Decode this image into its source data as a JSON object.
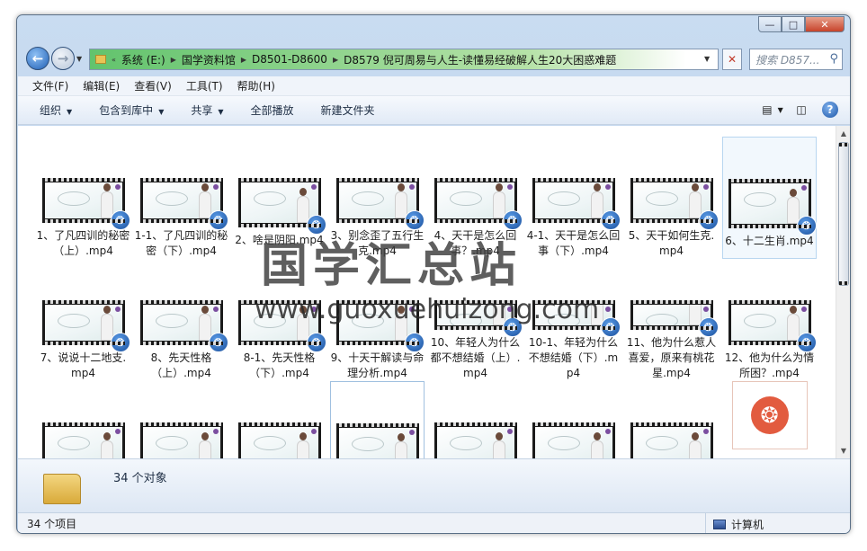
{
  "address": {
    "overflow": "«",
    "crumbs": [
      "系统 (E:)",
      "国学资料馆",
      "D8501-D8600",
      "D8579 倪可周易与人生-读懂易经破解人生20大困惑难题"
    ]
  },
  "search": {
    "placeholder": "搜索 D857..."
  },
  "menu": [
    "文件(F)",
    "编辑(E)",
    "查看(V)",
    "工具(T)",
    "帮助(H)"
  ],
  "toolbar": {
    "organize": "组织",
    "include": "包含到库中",
    "share": "共享",
    "play_all": "全部播放",
    "new_folder": "新建文件夹"
  },
  "files": [
    "1、了凡四训的秘密（上）.mp4",
    "1-1、了凡四训的秘密（下）.mp4",
    "2、啥是阴阳.mp4",
    "3、别念歪了五行生克.mp4",
    "4、天干是怎么回事？.mp4",
    "4-1、天干是怎么回事（下）.mp4",
    "5、天干如何生克.mp4",
    "6、十二生肖.mp4",
    "7、说说十二地支.mp4",
    "8、先天性格（上）.mp4",
    "8-1、先天性格（下）.mp4",
    "9、十天干解读与命理分析.mp4",
    "10、年轻人为什么都不想结婚（上）.mp4",
    "10-1、年轻为什么不想结婚（下）.mp4",
    "11、他为什么惹人喜爱，原来有桃花星.mp4",
    "12、他为什么为情所困？.mp4"
  ],
  "watermark": {
    "title": "国学汇总站",
    "url": "www.guoxuehuizong.com"
  },
  "details": {
    "count": "34 个对象"
  },
  "status": {
    "items": "34 个项目",
    "location": "计算机"
  },
  "colors": {
    "accent": "#1f5fb5",
    "address_progress": "#62c36d",
    "badge": "#1a4f9c",
    "mp4_reel": "#e25b3f"
  }
}
